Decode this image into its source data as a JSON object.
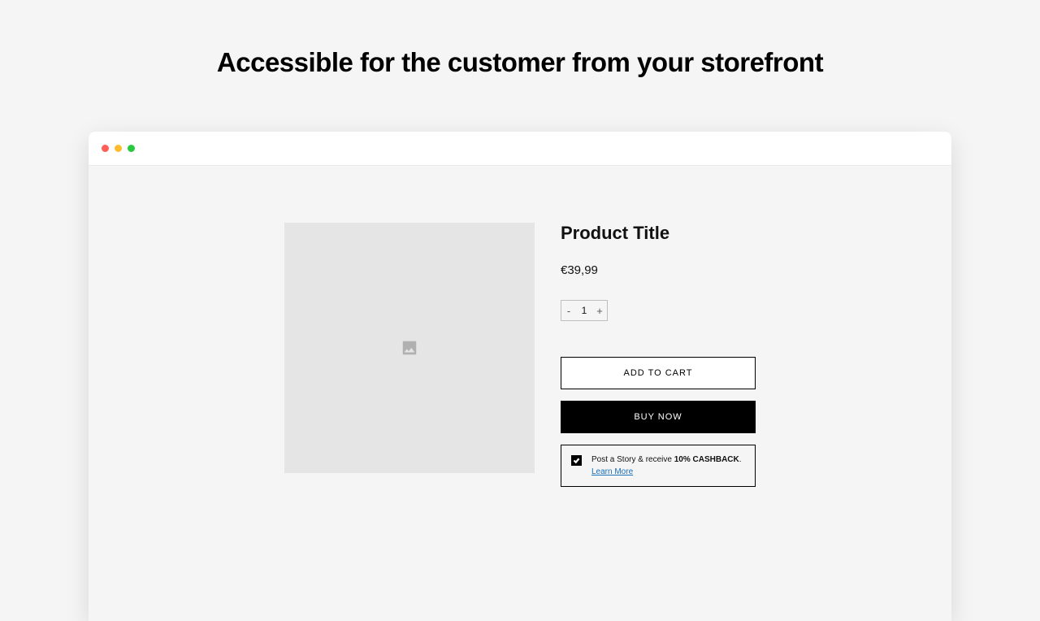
{
  "headline": "Accessible for the customer from your storefront",
  "product": {
    "title": "Product Title",
    "price": "€39,99",
    "quantity": "1",
    "qty_minus": "-",
    "qty_plus": "+",
    "add_to_cart": "ADD TO CART",
    "buy_now": "BUY NOW"
  },
  "cashback": {
    "prefix": "Post a Story & receive ",
    "highlight": "10% CASHBACK",
    "suffix": ".",
    "learn_more": "Learn More"
  }
}
